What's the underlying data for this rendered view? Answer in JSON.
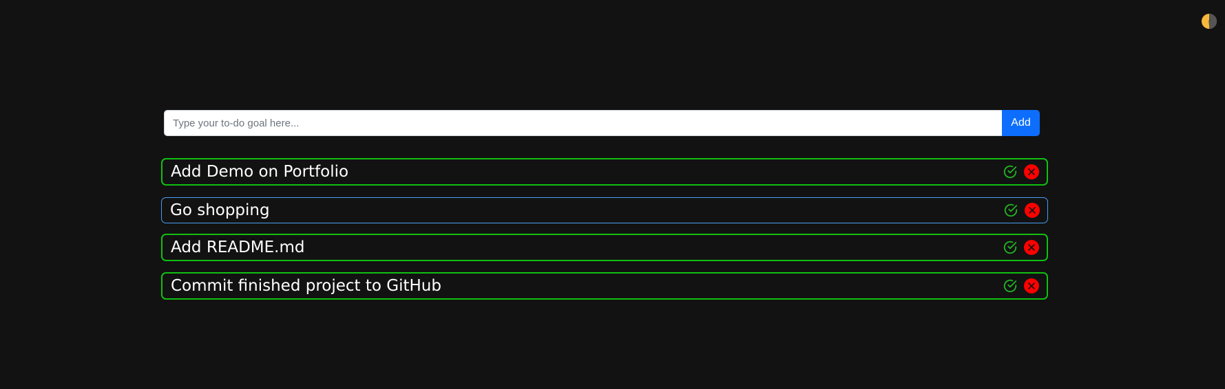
{
  "input": {
    "placeholder": "Type your to-do goal here...",
    "value": ""
  },
  "add_button": {
    "label": "Add"
  },
  "todos": [
    {
      "text": "Add Demo on Portfolio"
    },
    {
      "text": "Go shopping"
    },
    {
      "text": "Add README.md"
    },
    {
      "text": "Commit finished project to GitHub"
    }
  ],
  "icons": {
    "theme_toggle": "sun-moon-icon",
    "complete": "check-circle-icon",
    "delete": "x-circle-icon"
  },
  "colors": {
    "background": "#121212",
    "accent_blue": "#0d6efd",
    "item_border_green": "#11c011",
    "item_border_active": "#4a9ff5",
    "delete_red": "#ff0000",
    "check_green": "#22b422",
    "theme_toggle_yellow": "#f6b93b"
  }
}
